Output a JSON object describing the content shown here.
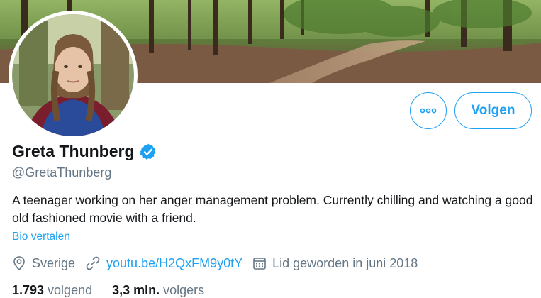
{
  "profile": {
    "display_name": "Greta Thunberg",
    "handle": "@GretaThunberg",
    "bio": "A teenager working on her anger management problem. Currently chilling and watching a good old fashioned movie with a friend.",
    "translate_label": "Bio vertalen",
    "location": "Sverige",
    "website": "youtu.be/H2QxFM9y0tY",
    "joined": "Lid geworden in juni 2018"
  },
  "actions": {
    "follow_label": "Volgen"
  },
  "stats": {
    "following_count": "1.793",
    "following_label": "volgend",
    "followers_count": "3,3 mln.",
    "followers_label": "volgers"
  },
  "colors": {
    "accent": "#1da1f2",
    "secondary_text": "#657786",
    "primary_text": "#14171a"
  },
  "icons": [
    "more-icon",
    "verified-badge-icon",
    "location-icon",
    "link-icon",
    "calendar-icon"
  ]
}
